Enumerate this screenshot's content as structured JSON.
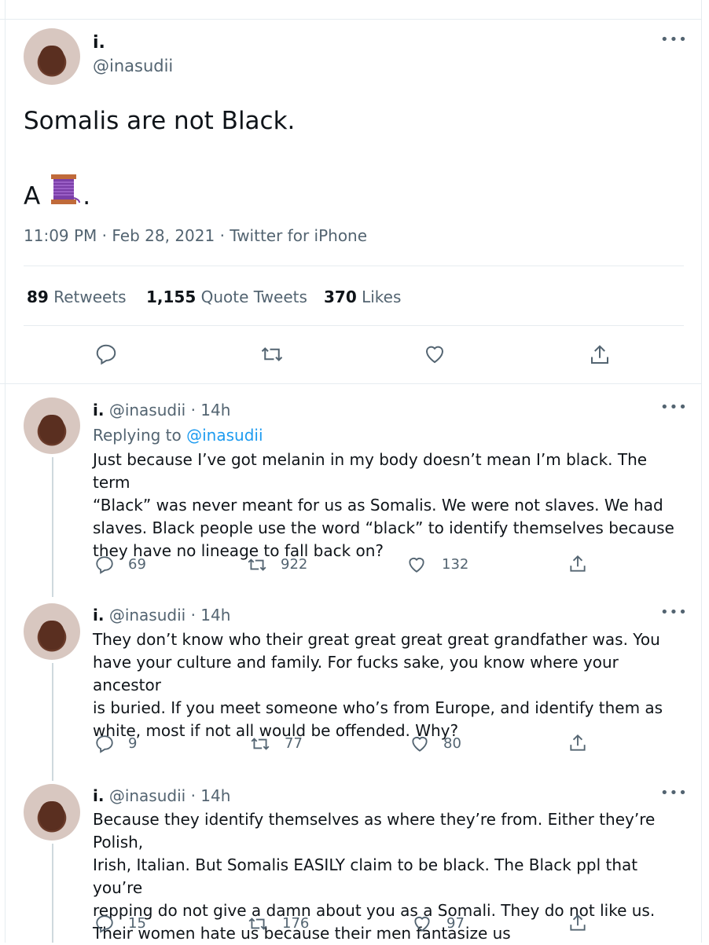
{
  "main_tweet": {
    "author_name": "i.",
    "author_handle": "@inasudii",
    "text_line1": "Somalis are not Black.",
    "text_line2_prefix": "A",
    "text_line2_suffix": ".",
    "emoji": "thread-spool-icon",
    "meta": "11:09 PM · Feb 28, 2021 · Twitter for iPhone",
    "retweets_count": "89",
    "retweets_label": "Retweets",
    "quotes_count": "1,155",
    "quotes_label": "Quote Tweets",
    "likes_count": "370",
    "likes_label": "Likes"
  },
  "replies": [
    {
      "name": "i.",
      "handle_time": "@inasudii · 14h",
      "replying_prefix": "Replying to",
      "replying_to": "@inasudii",
      "lines": [
        "Just because I’ve got melanin in my body  doesn’t mean I’m black. The term",
        "“Black” was never meant for us as Somalis. We were not slaves. We had",
        "slaves. Black people use the word “black” to identify themselves because",
        "they have no lineage to fall back on?"
      ],
      "replies": "69",
      "retweets": "922",
      "likes": "132"
    },
    {
      "name": "i.",
      "handle_time": "@inasudii · 14h",
      "lines": [
        "They don’t know who their great great great great grandfather was. You",
        "have your culture and family. For fucks sake, you know where your ancestor",
        "is buried. If you meet someone who’s from Europe, and identify them as",
        "white, most if not all would be offended. Why?"
      ],
      "replies": "9",
      "retweets": "77",
      "likes": "80"
    },
    {
      "name": "i.",
      "handle_time": "@inasudii · 14h",
      "lines": [
        "Because they identify themselves as where they’re from. Either they’re Polish,",
        "Irish, Italian. But Somalis EASILY claim to be black. The Black ppl that you’re",
        "repping do not give a damn about you as a Somali. They do not like us.",
        "Their women hate us because their men fantasize us"
      ],
      "replies": "15",
      "retweets": "176",
      "likes": "97"
    }
  ],
  "icons": {
    "more": "more-dots-icon",
    "reply": "reply-icon",
    "retweet": "retweet-icon",
    "like": "heart-icon",
    "share": "share-icon"
  },
  "colors": {
    "link": "#1d9bf0",
    "muted": "#536471",
    "divider": "#e6ecf0"
  }
}
